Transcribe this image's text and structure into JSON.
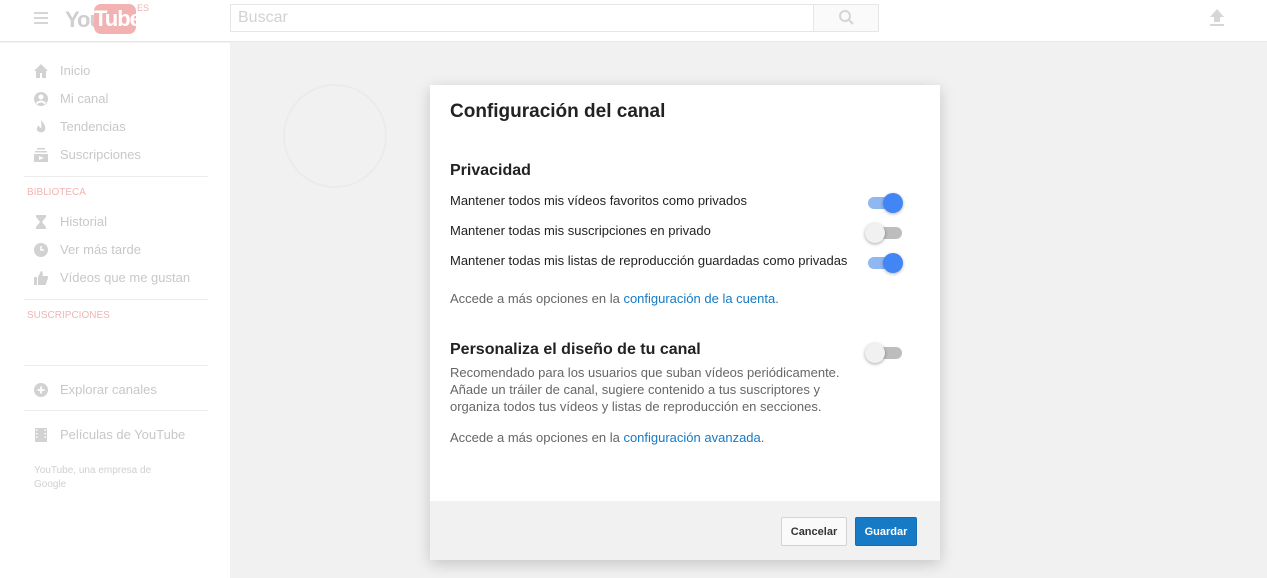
{
  "masthead": {
    "logo_you": "You",
    "logo_tube": "Tube",
    "logo_country": "ES",
    "search_placeholder": "Buscar"
  },
  "sidebar": {
    "main_items": [
      {
        "label": "Inicio",
        "icon": "home-icon"
      },
      {
        "label": "Mi canal",
        "icon": "account-icon"
      },
      {
        "label": "Tendencias",
        "icon": "flame-icon"
      },
      {
        "label": "Suscripciones",
        "icon": "subscriptions-icon"
      }
    ],
    "library_title": "BIBLIOTECA",
    "library_items": [
      {
        "label": "Historial",
        "icon": "hourglass-icon"
      },
      {
        "label": "Ver más tarde",
        "icon": "clock-icon"
      },
      {
        "label": "Vídeos que me gustan",
        "icon": "thumbs-up-icon"
      }
    ],
    "subscriptions_title": "SUSCRIPCIONES",
    "browse_channels": "Explorar canales",
    "movies": "Películas de YouTube",
    "footer": "YouTube, una empresa de Google"
  },
  "dialog": {
    "title": "Configuración del canal",
    "privacy": {
      "heading": "Privacidad",
      "options": [
        {
          "label": "Mantener todos mis vídeos favoritos como privados",
          "enabled": true
        },
        {
          "label": "Mantener todas mis suscripciones en privado",
          "enabled": false
        },
        {
          "label": "Mantener todas mis listas de reproducción guardadas como privadas",
          "enabled": true
        }
      ],
      "hint_prefix": "Accede a más opciones en la ",
      "hint_link": "configuración de la cuenta",
      "hint_suffix": "."
    },
    "customize": {
      "heading": "Personaliza el diseño de tu canal",
      "enabled": false,
      "description": "Recomendado para los usuarios que suban vídeos periódicamente. Añade un tráiler de canal, sugiere contenido a tus suscriptores y organiza todos tus vídeos y listas de reproducción en secciones.",
      "hint_prefix": "Accede a más opciones en la ",
      "hint_link": "configuración avanzada",
      "hint_suffix": "."
    },
    "cancel_label": "Cancelar",
    "save_label": "Guardar"
  },
  "colors": {
    "accent": "#4285f4",
    "link": "#167ac6",
    "brand_red": "#e62117"
  }
}
